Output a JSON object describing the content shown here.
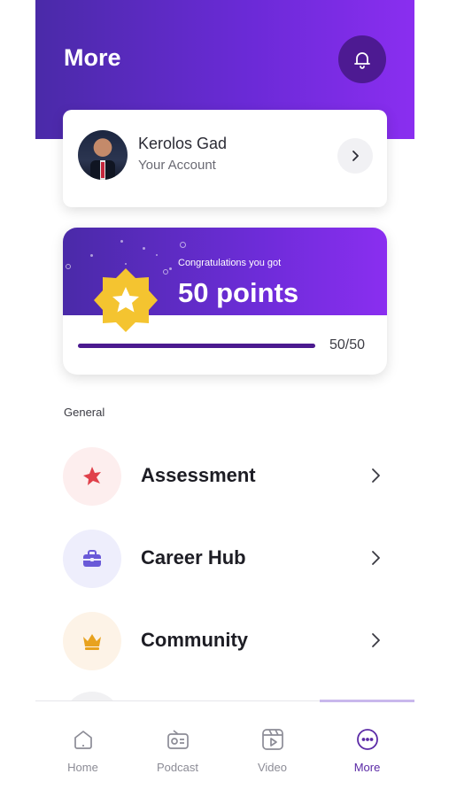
{
  "header": {
    "title": "More"
  },
  "account": {
    "name": "Kerolos Gad",
    "subtitle": "Your Account"
  },
  "points": {
    "congrats": "Congratulations you got",
    "headline": "50 points",
    "progress_text": "50/50",
    "progress_fraction": 1.0
  },
  "section": {
    "label": "General"
  },
  "menu": [
    {
      "label": "Assessment",
      "icon": "star-burst-icon",
      "icon_color": "#e0404a",
      "bg": "#fdeeee"
    },
    {
      "label": "Career Hub",
      "icon": "briefcase-icon",
      "icon_color": "#6a5ad8",
      "bg": "#eeeefc"
    },
    {
      "label": "Community",
      "icon": "crown-icon",
      "icon_color": "#e8a21e",
      "bg": "#fdf3e7"
    }
  ],
  "nav": [
    {
      "label": "Home",
      "icon": "home-icon",
      "active": false
    },
    {
      "label": "Podcast",
      "icon": "podcast-icon",
      "active": false
    },
    {
      "label": "Video",
      "icon": "video-icon",
      "active": false
    },
    {
      "label": "More",
      "icon": "more-icon",
      "active": true
    }
  ],
  "colors": {
    "primary": "#6a2ad6",
    "accent_dark": "#4b1a8f",
    "badge_yellow": "#f4c430"
  }
}
